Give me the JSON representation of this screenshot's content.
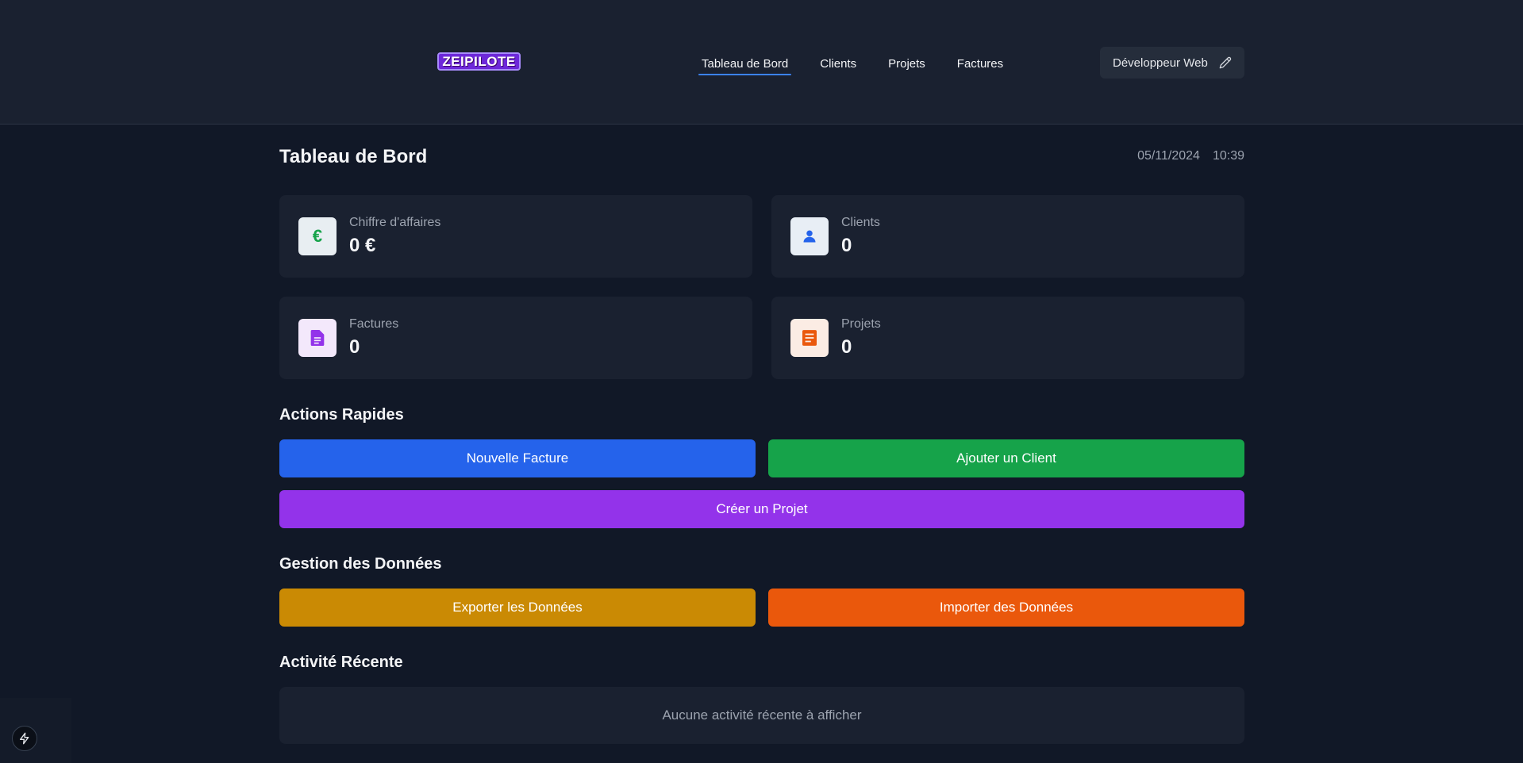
{
  "header": {
    "logo_text": "ZEIPILOTE",
    "nav": [
      {
        "label": "Tableau de Bord",
        "active": true
      },
      {
        "label": "Clients",
        "active": false
      },
      {
        "label": "Projets",
        "active": false
      },
      {
        "label": "Factures",
        "active": false
      }
    ],
    "profile_label": "Développeur Web",
    "profile_icon": "pencil-icon"
  },
  "page": {
    "title": "Tableau de Bord",
    "date": "05/11/2024",
    "time": "10:39"
  },
  "stats": [
    {
      "label": "Chiffre d'affaires",
      "value": "0 €",
      "icon": "euro-icon",
      "icon_glyph": "€",
      "icon_color": "#16a34a",
      "icon_bg": "#e8eef2"
    },
    {
      "label": "Clients",
      "value": "0",
      "icon": "user-icon",
      "icon_color": "#2563eb",
      "icon_bg": "#e8eef5"
    },
    {
      "label": "Factures",
      "value": "0",
      "icon": "document-icon",
      "icon_color": "#9333ea",
      "icon_bg": "#f3e8fb"
    },
    {
      "label": "Projets",
      "value": "0",
      "icon": "list-document-icon",
      "icon_color": "#ea580c",
      "icon_bg": "#fbece4"
    }
  ],
  "quick_actions": {
    "title": "Actions Rapides",
    "new_invoice": "Nouvelle Facture",
    "add_client": "Ajouter un Client",
    "create_project": "Créer un Projet"
  },
  "data_management": {
    "title": "Gestion des Données",
    "export": "Exporter les Données",
    "import": "Importer des Données"
  },
  "recent_activity": {
    "title": "Activité Récente",
    "empty": "Aucune activité récente à afficher"
  },
  "colors": {
    "blue": "#2563eb",
    "green": "#16a34a",
    "purple": "#9333ea",
    "amber": "#ca8a04",
    "orange": "#ea580c"
  },
  "floating_icon": "bolt-icon"
}
